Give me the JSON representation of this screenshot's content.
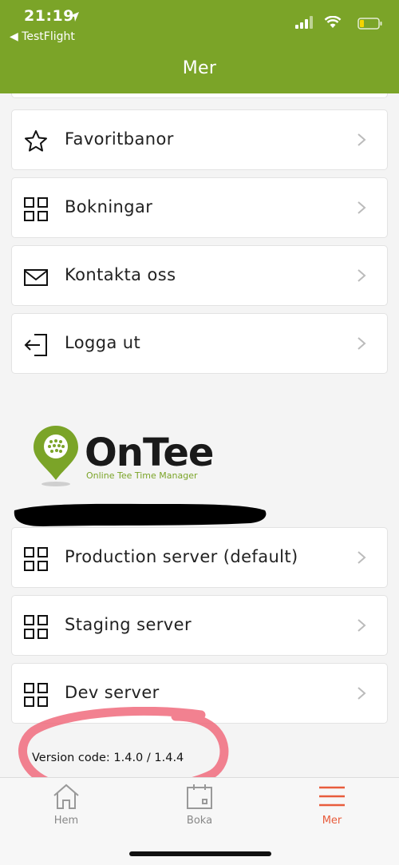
{
  "status_bar": {
    "time": "21:19",
    "back_app": "◀ TestFlight"
  },
  "nav": {
    "title": "Mer"
  },
  "menu": {
    "items": [
      {
        "label": "Favoritbanor",
        "icon": "star-icon"
      },
      {
        "label": "Bokningar",
        "icon": "grid-icon"
      },
      {
        "label": "Kontakta oss",
        "icon": "mail-icon"
      },
      {
        "label": "Logga ut",
        "icon": "logout-icon"
      }
    ]
  },
  "logo": {
    "title": "OnTee",
    "subtitle": "Online Tee Time Manager"
  },
  "servers": {
    "items": [
      {
        "label": "Production server (default)",
        "icon": "grid-icon"
      },
      {
        "label": "Staging server",
        "icon": "grid-icon"
      },
      {
        "label": "Dev server",
        "icon": "grid-icon"
      }
    ]
  },
  "version": {
    "text": "Version code: 1.4.0 / 1.4.4"
  },
  "tabbar": {
    "tabs": [
      {
        "label": "Hem",
        "icon": "home-icon"
      },
      {
        "label": "Boka",
        "icon": "calendar-icon"
      },
      {
        "label": "Mer",
        "icon": "menu-icon",
        "active": true
      }
    ]
  },
  "colors": {
    "brand_green": "#7ba428",
    "active_tab": "#e85c3c",
    "annotation_circle": "#f06b7d"
  }
}
